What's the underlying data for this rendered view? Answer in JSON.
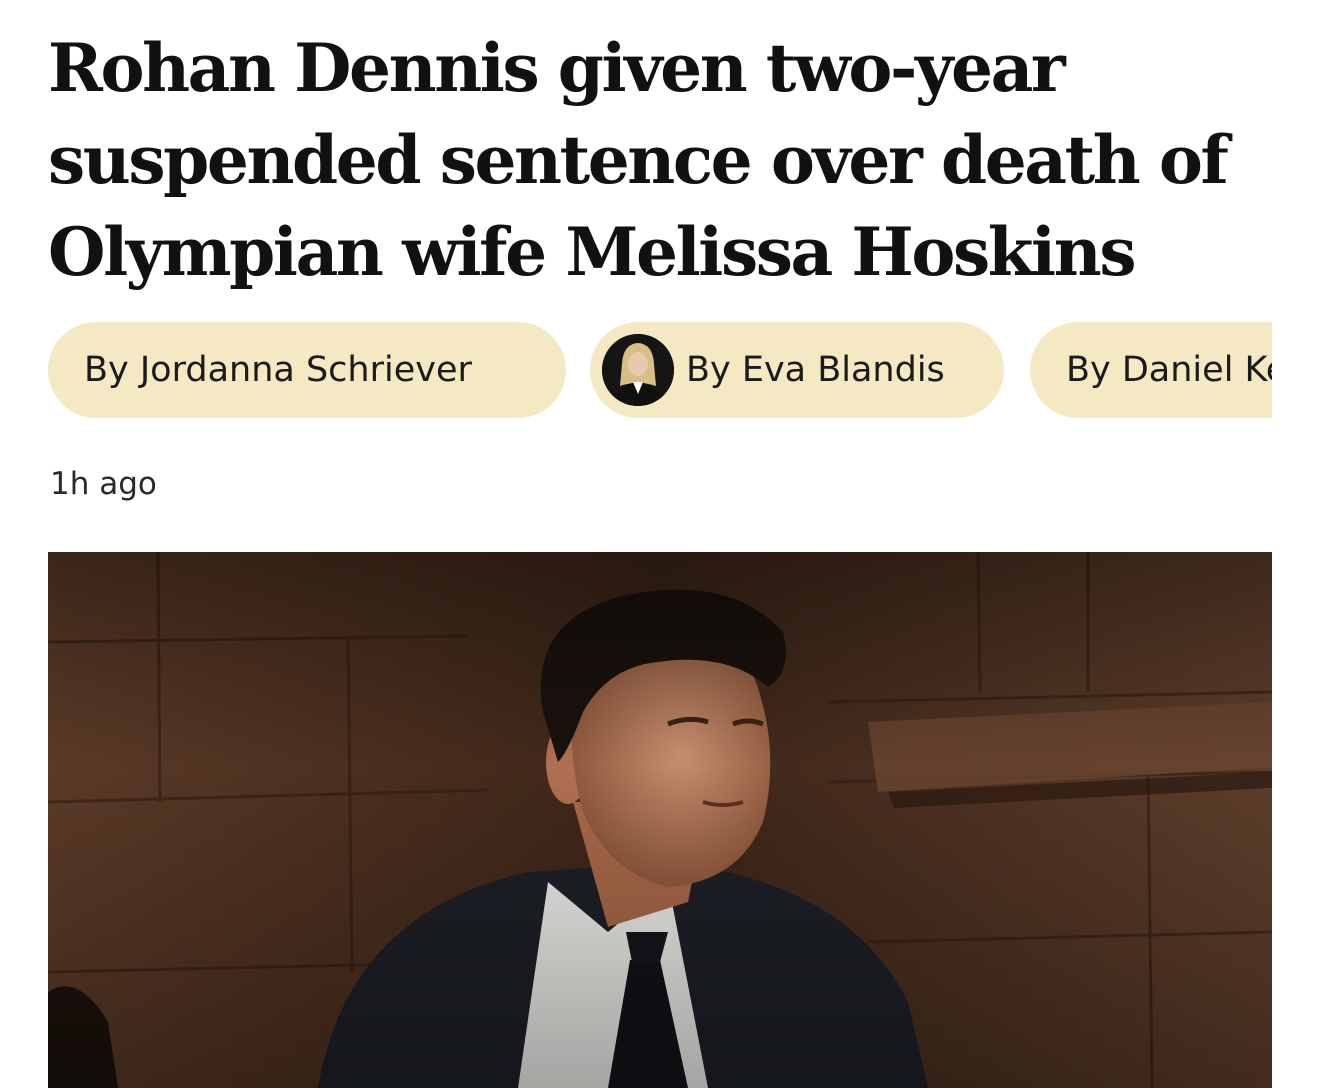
{
  "article": {
    "headline": "Rohan Dennis given two-year suspended sentence over death of Olympian wife Melissa Hoskins",
    "timestamp": "1h ago"
  },
  "bylines": [
    {
      "label": "By Jordanna Schriever",
      "has_avatar": false
    },
    {
      "label": "By Eva Blandis",
      "has_avatar": true
    },
    {
      "label": "By Daniel Keane",
      "has_avatar": false
    }
  ],
  "colors": {
    "pill_background": "#f5e9c4",
    "headline_text": "#111111"
  }
}
